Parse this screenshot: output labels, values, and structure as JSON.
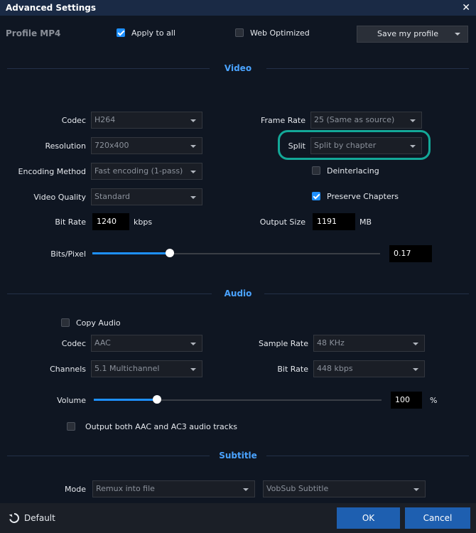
{
  "window": {
    "title": "Advanced Settings",
    "close_glyph": "✕"
  },
  "header": {
    "profile": "Profile  MP4",
    "apply_to_all": {
      "label": "Apply to all",
      "checked": true
    },
    "web_optimized": {
      "label": "Web Optimized",
      "checked": false
    },
    "save_profile": "Save my profile"
  },
  "video": {
    "section": "Video",
    "codec": {
      "label": "Codec",
      "value": "H264"
    },
    "resolution": {
      "label": "Resolution",
      "value": "720x400"
    },
    "encoding_method": {
      "label": "Encoding Method",
      "value": "Fast encoding (1-pass)"
    },
    "video_quality": {
      "label": "Video Quality",
      "value": "Standard"
    },
    "bit_rate": {
      "label": "Bit Rate",
      "value": "1240",
      "unit": "kbps"
    },
    "frame_rate": {
      "label": "Frame Rate",
      "value": "25 (Same as source)"
    },
    "split": {
      "label": "Split",
      "value": "Split by chapter"
    },
    "deinterlacing": {
      "label": "Deinterlacing",
      "checked": false
    },
    "preserve_chapters": {
      "label": "Preserve Chapters",
      "checked": true
    },
    "output_size": {
      "label": "Output Size",
      "value": "1191",
      "unit": "MB"
    },
    "bits_pixel": {
      "label": "Bits/Pixel",
      "value": "0.17",
      "slider_fraction": 0.27
    }
  },
  "audio": {
    "section": "Audio",
    "copy_audio": {
      "label": "Copy Audio",
      "checked": false
    },
    "codec": {
      "label": "Codec",
      "value": "AAC"
    },
    "channels": {
      "label": "Channels",
      "value": "5.1 Multichannel"
    },
    "sample_rate": {
      "label": "Sample Rate",
      "value": "48 KHz"
    },
    "bit_rate": {
      "label": "Bit Rate",
      "value": "448 kbps"
    },
    "volume": {
      "label": "Volume",
      "value": "100",
      "unit": "%",
      "slider_fraction": 0.22
    },
    "output_both": {
      "label": "Output both AAC and AC3 audio tracks",
      "checked": false
    }
  },
  "subtitle": {
    "section": "Subtitle",
    "mode": {
      "label": "Mode",
      "value": "Remux into file"
    },
    "type": {
      "value": "VobSub Subtitle"
    }
  },
  "footer": {
    "default": "Default",
    "ok": "OK",
    "cancel": "Cancel"
  },
  "colors": {
    "accent": "#1e90ff",
    "section_title": "#4aa3ff",
    "highlight": "#13a898",
    "button": "#1e5fb0"
  }
}
